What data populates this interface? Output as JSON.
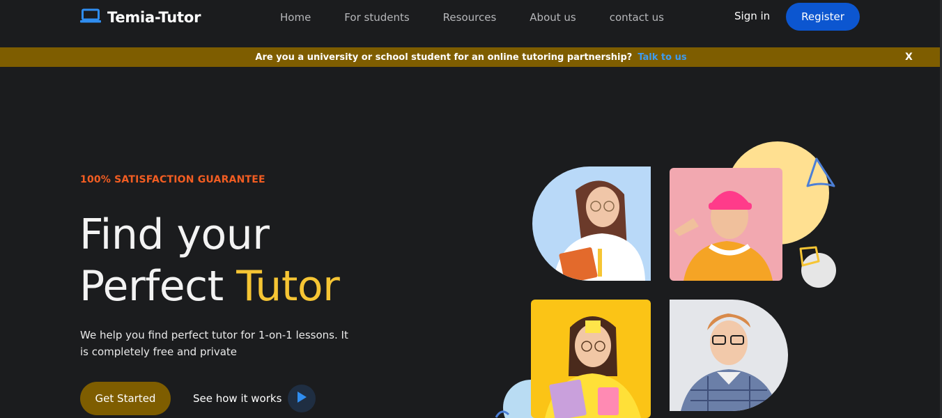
{
  "nav": {
    "brand": "Temia-Tutor",
    "links": [
      "Home",
      "For students",
      "Resources",
      "About us",
      "contact us"
    ],
    "sign_in": "Sign in",
    "register": "Register"
  },
  "banner": {
    "text": "Are you a university or school student for an online tutoring partnership?",
    "link": "Talk to us",
    "close": "X"
  },
  "hero": {
    "eyebrow": "100% SATISFACTION GUARANTEE",
    "title_line1": "Find your",
    "title_line2_plain": "Perfect",
    "title_line2_accent": "Tutor",
    "description": "We help you find perfect tutor for 1-on-1 lessons. It is completely free and private",
    "cta_primary": "Get Started",
    "cta_secondary": "See how it works"
  },
  "icons": {
    "logo": "laptop-icon",
    "play": "play-icon"
  },
  "colors": {
    "background": "#1b1c1e",
    "brand_gold": "#7e5d00",
    "accent_yellow": "#f6c534",
    "eyebrow_orange": "#f25d22",
    "register_blue": "#0c56d0",
    "link_blue": "#3d9bf0"
  }
}
